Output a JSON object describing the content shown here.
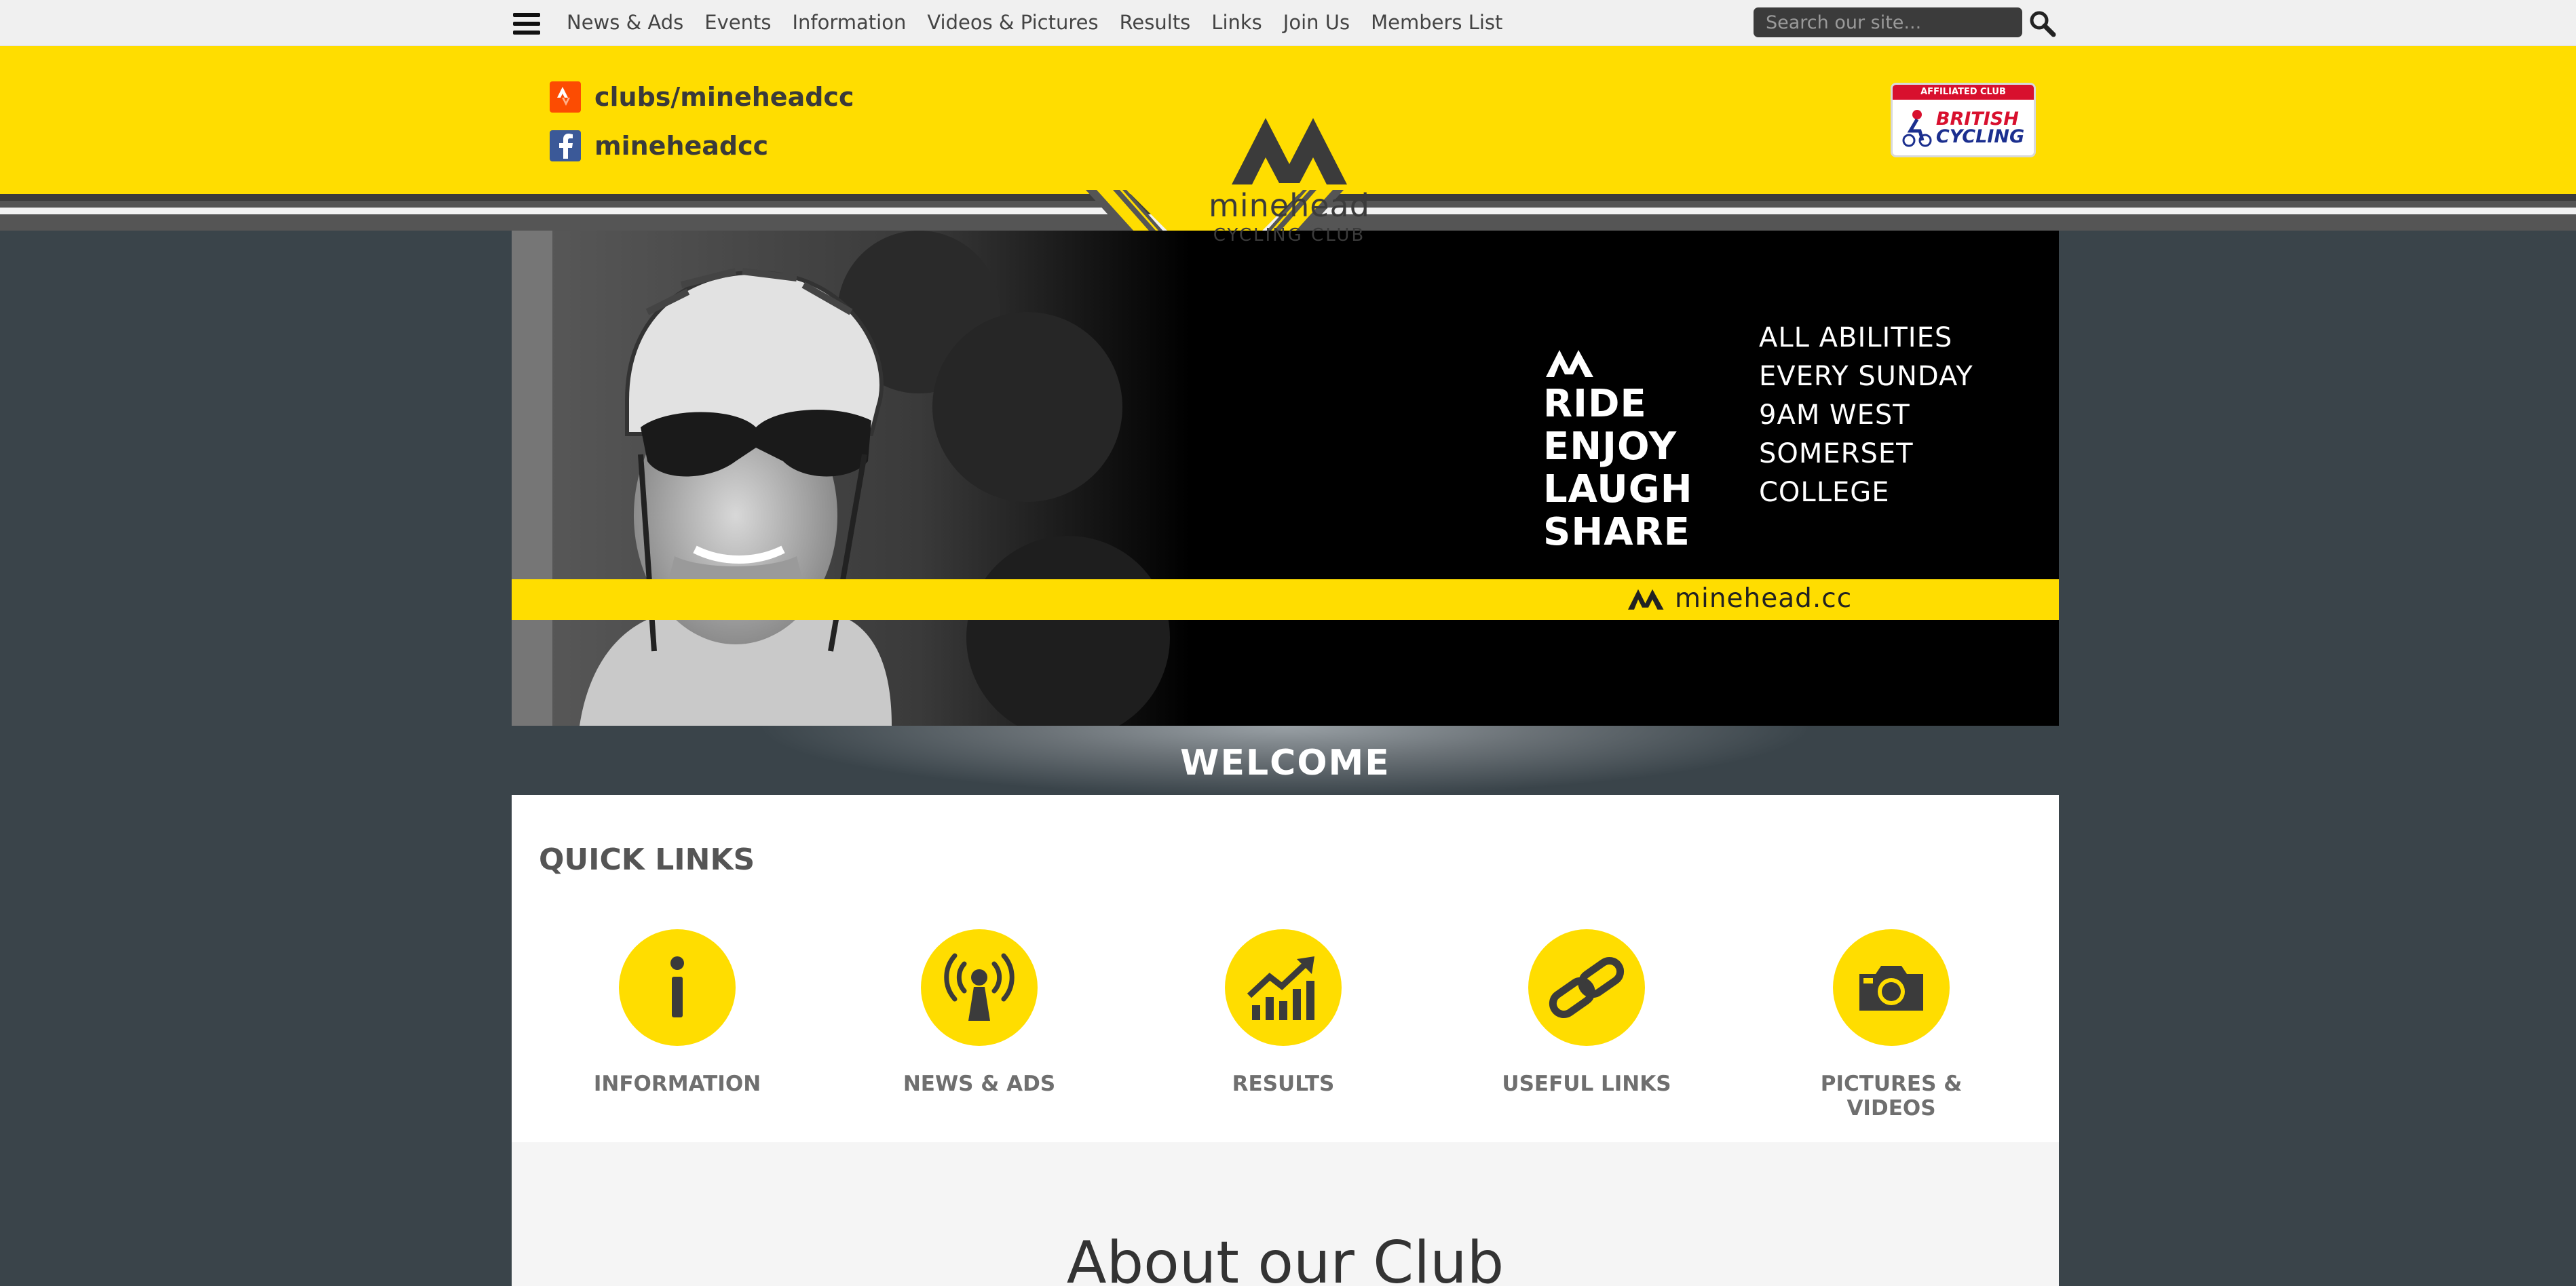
{
  "nav": {
    "items": [
      "News & Ads",
      "Events",
      "Information",
      "Videos & Pictures",
      "Results",
      "Links",
      "Join Us",
      "Members List"
    ],
    "search_placeholder": "Search our site..."
  },
  "header": {
    "strava": "clubs/mineheadcc",
    "facebook": "mineheadcc",
    "logo_name": "minehead",
    "logo_sub": "CYCLING CLUB",
    "badge_top": "AFFILIATED CLUB",
    "badge_line1": "BRITISH",
    "badge_line2": "CYCLING"
  },
  "banner": {
    "words": [
      "RIDE",
      "ENJOY",
      "LAUGH",
      "SHARE"
    ],
    "info": [
      "ALL ABILITIES",
      "EVERY SUNDAY",
      "9AM  WEST",
      "SOMERSET",
      "COLLEGE"
    ],
    "url": "minehead.cc"
  },
  "welcome": "WELCOME",
  "quick_links": {
    "title": "QUICK LINKS",
    "items": [
      {
        "label": "INFORMATION",
        "icon": "info-icon"
      },
      {
        "label": "NEWS & ADS",
        "icon": "broadcast-icon"
      },
      {
        "label": "RESULTS",
        "icon": "chart-icon"
      },
      {
        "label": "USEFUL LINKS",
        "icon": "link-icon"
      },
      {
        "label": "PICTURES & VIDEOS",
        "icon": "camera-icon"
      }
    ]
  },
  "about": {
    "title": "About our Club"
  },
  "colors": {
    "accent": "#ffdd00",
    "background": "#3a444a",
    "dark": "#3b3b3b"
  }
}
